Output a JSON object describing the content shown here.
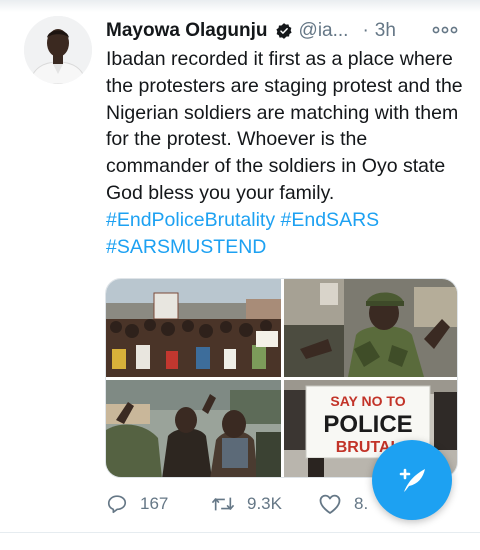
{
  "tweet": {
    "author_name": "Mayowa Olagunju",
    "handle": "@ia...",
    "separator": "·",
    "time": "3h",
    "text": "Ibadan recorded it first as a place where the protesters are staging protest and the Nigerian soldiers are matching with them for the protest. Whoever is the commander of the soldiers in Oyo state God bless you your family.",
    "hashtags": [
      "#EndPoliceBrutality",
      "#EndSARS",
      "#SARSMUSTEND"
    ],
    "media": {
      "photo_1": {
        "sign_text": ""
      },
      "photo_2": {},
      "photo_3": {},
      "photo_4": {
        "placard_lines": [
          "SAY NO TO",
          "POLICE",
          "BRUTAL"
        ]
      }
    },
    "actions": {
      "reply_count": "167",
      "retweet_count": "9.3K",
      "like_count": "8."
    }
  },
  "icons": {
    "verified": "verified-badge-icon",
    "more": "more-options-icon",
    "reply": "reply-icon",
    "retweet": "retweet-icon",
    "like": "heart-icon",
    "compose": "compose-tweet-icon"
  },
  "colors": {
    "accent": "#1da1f2",
    "text": "#14171a",
    "secondary": "#657786"
  }
}
